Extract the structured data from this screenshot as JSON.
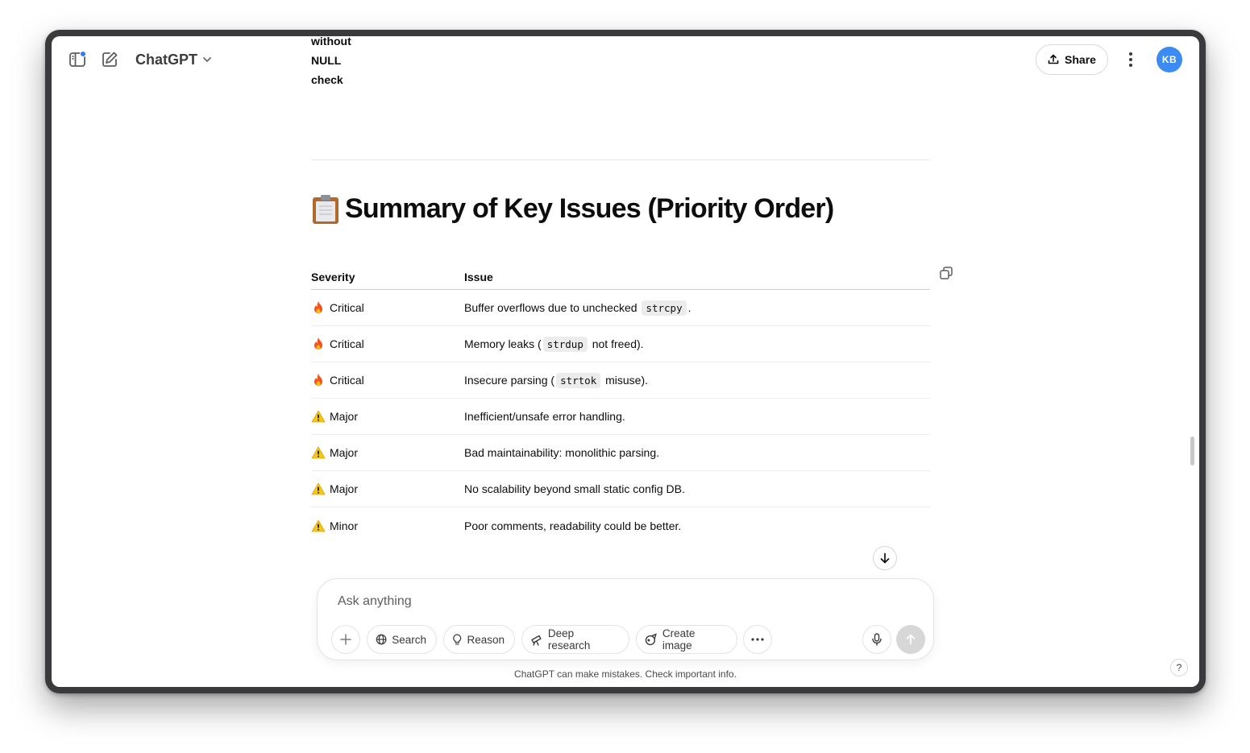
{
  "header": {
    "model_name": "ChatGPT",
    "share_label": "Share",
    "avatar_initials": "KB"
  },
  "previous_text": [
    "without",
    "NULL",
    "check"
  ],
  "section": {
    "emoji": "📋",
    "title": "Summary of Key Issues (Priority Order)"
  },
  "table": {
    "headers": [
      "Severity",
      "Issue"
    ],
    "rows": [
      {
        "icon": "fire-icon",
        "severity": "Critical",
        "pre": "Buffer overflows due to unchecked ",
        "code": "strcpy",
        "post": "."
      },
      {
        "icon": "fire-icon",
        "severity": "Critical",
        "pre": "Memory leaks (",
        "code": "strdup",
        "post": " not freed)."
      },
      {
        "icon": "fire-icon",
        "severity": "Critical",
        "pre": "Insecure parsing (",
        "code": "strtok",
        "post": " misuse)."
      },
      {
        "icon": "warning-icon",
        "severity": "Major",
        "pre": "Inefficient/unsafe error handling.",
        "code": "",
        "post": ""
      },
      {
        "icon": "warning-icon",
        "severity": "Major",
        "pre": "Bad maintainability: monolithic parsing.",
        "code": "",
        "post": ""
      },
      {
        "icon": "warning-icon",
        "severity": "Major",
        "pre": "No scalability beyond small static config DB.",
        "code": "",
        "post": ""
      },
      {
        "icon": "warning-icon",
        "severity": "Minor",
        "pre": "Poor comments, readability could be better.",
        "code": "",
        "post": ""
      }
    ]
  },
  "composer": {
    "placeholder": "Ask anything",
    "tools": {
      "search": "Search",
      "reason": "Reason",
      "deep_research": "Deep research",
      "create_image": "Create image"
    }
  },
  "footer": {
    "disclaimer": "ChatGPT can make mistakes. Check important info.",
    "help": "?"
  },
  "colors": {
    "accent_blue": "#3b8bf3",
    "fire": "#f4511e",
    "warning": "#f5c518"
  }
}
